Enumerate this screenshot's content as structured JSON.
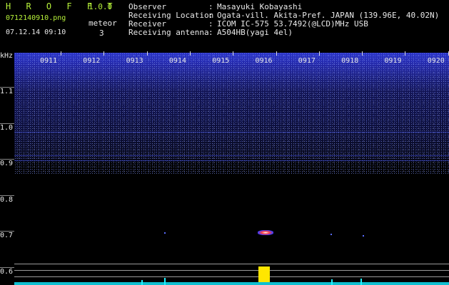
{
  "app": {
    "title": "H R O F F T",
    "version": "1.0.0"
  },
  "capture": {
    "filename": "0712140910.png",
    "datetime": "07.12.14 09:10",
    "meteor_label": "meteor",
    "meteor_count": "3"
  },
  "info": [
    {
      "label": "Observer",
      "value": "Masayuki Kobayashi"
    },
    {
      "label": "Receiving Location",
      "value": "Ogata-vill. Akita-Pref. JAPAN (139.96E, 40.02N)"
    },
    {
      "label": "Receiver",
      "value": "ICOM IC-575 53.7492(@LCD)MHz USB"
    },
    {
      "label": "Receiving antenna",
      "value": "A504HB(yagi 4el)"
    }
  ],
  "colon": ":",
  "spectrogram": {
    "y_unit": "kHz",
    "y_ticks": [
      "1.1",
      "1.0",
      "0.9",
      "0.8",
      "0.7",
      "0.6"
    ],
    "time_labels": [
      "0911",
      "0912",
      "0913",
      "0914",
      "0915",
      "0916",
      "0917",
      "0918",
      "0919",
      "0920"
    ],
    "colors": {
      "noise": "#2a33c8",
      "meteor": "#ff4040",
      "level": "#ffe600",
      "baseline": "#1ff2ff"
    }
  }
}
